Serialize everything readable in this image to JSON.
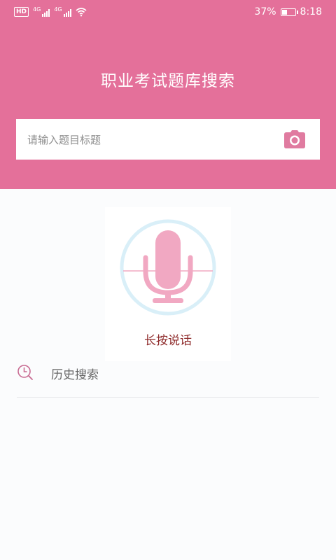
{
  "status_bar": {
    "hd": "HD",
    "net1": "4G",
    "net2": "4G",
    "battery_text": "37%",
    "battery_level": 0.37,
    "time": "8:18",
    "icons": [
      "signal-icon",
      "signal-icon",
      "wifi-icon",
      "battery-icon"
    ]
  },
  "header": {
    "title": "职业考试题库搜索",
    "color": "#e4709a"
  },
  "search": {
    "placeholder": "请输入题目标题",
    "value": "",
    "camera_icon": "camera-icon"
  },
  "voice": {
    "label": "长按说话",
    "icon": "microphone-icon",
    "mic_color": "#f1a8c2",
    "ring_color": "#d9eff8",
    "label_color": "#8e2a2a"
  },
  "history": {
    "label": "历史搜索",
    "icon": "clock-search-icon"
  }
}
